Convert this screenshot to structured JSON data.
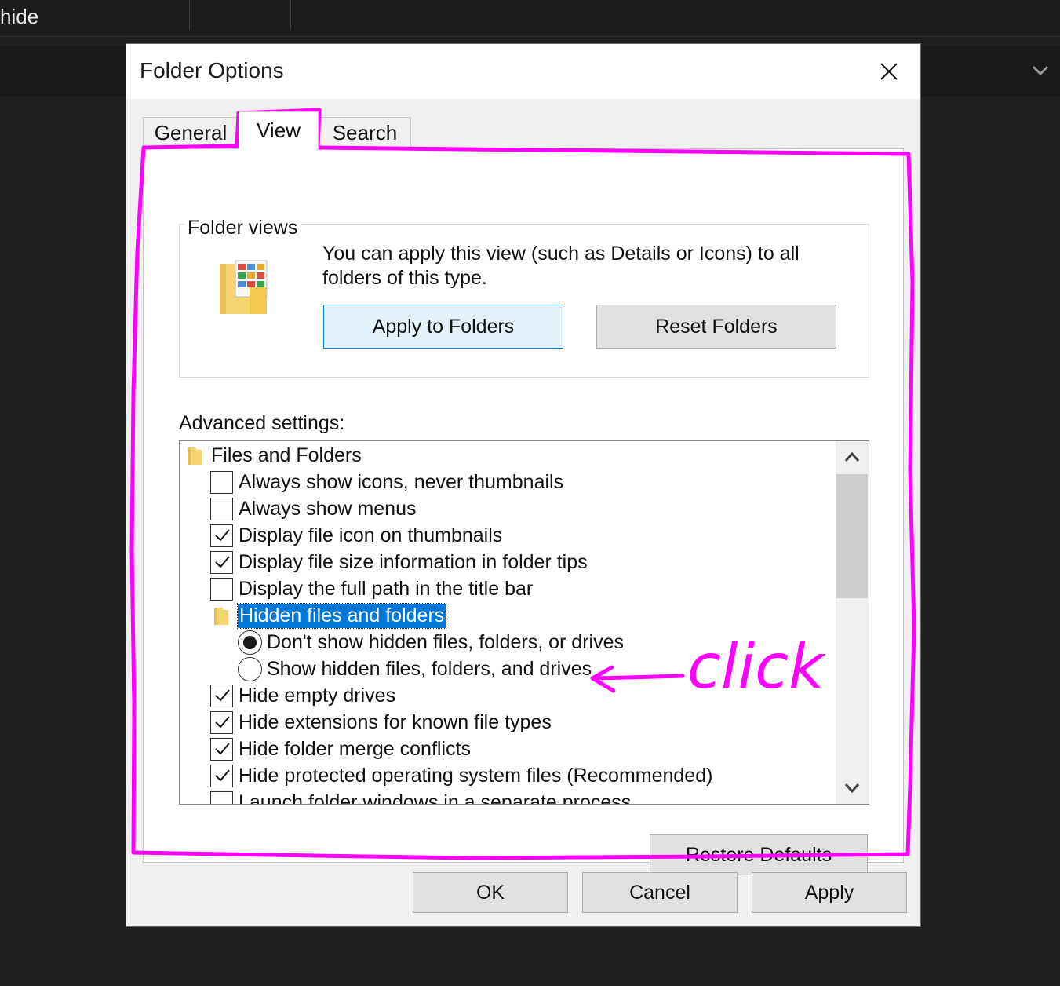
{
  "background": {
    "search_text": "hide"
  },
  "dialog": {
    "title": "Folder Options",
    "tabs": [
      {
        "label": "General"
      },
      {
        "label": "View"
      },
      {
        "label": "Search"
      }
    ],
    "folder_views": {
      "group_label": "Folder views",
      "description": "You can apply this view (such as Details or Icons) to all folders of this type.",
      "apply_button": "Apply to Folders",
      "reset_button": "Reset Folders"
    },
    "advanced": {
      "label": "Advanced settings:",
      "items": [
        {
          "type": "folder",
          "label": "Files and Folders"
        },
        {
          "type": "checkbox",
          "checked": false,
          "label": "Always show icons, never thumbnails"
        },
        {
          "type": "checkbox",
          "checked": false,
          "label": "Always show menus"
        },
        {
          "type": "checkbox",
          "checked": true,
          "label": "Display file icon on thumbnails"
        },
        {
          "type": "checkbox",
          "checked": true,
          "label": "Display file size information in folder tips"
        },
        {
          "type": "checkbox",
          "checked": false,
          "label": "Display the full path in the title bar"
        },
        {
          "type": "folder",
          "label": "Hidden files and folders",
          "selected": true
        },
        {
          "type": "radio",
          "checked": true,
          "label": "Don't show hidden files, folders, or drives"
        },
        {
          "type": "radio",
          "checked": false,
          "label": "Show hidden files, folders, and drives"
        },
        {
          "type": "checkbox",
          "checked": true,
          "label": "Hide empty drives"
        },
        {
          "type": "checkbox",
          "checked": true,
          "label": "Hide extensions for known file types"
        },
        {
          "type": "checkbox",
          "checked": true,
          "label": "Hide folder merge conflicts"
        },
        {
          "type": "checkbox",
          "checked": true,
          "label": "Hide protected operating system files (Recommended)"
        },
        {
          "type": "checkbox",
          "checked": false,
          "label": "Launch folder windows in a separate process"
        }
      ]
    },
    "restore_button": "Restore Defaults",
    "ok_button": "OK",
    "cancel_button": "Cancel",
    "apply_button": "Apply"
  },
  "annotation": {
    "text": "click",
    "color": "#ff00ff"
  },
  "colors": {
    "selection": "#0078d7",
    "focused_button_bg": "#e5f1fb",
    "dark_bg": "#202020"
  }
}
